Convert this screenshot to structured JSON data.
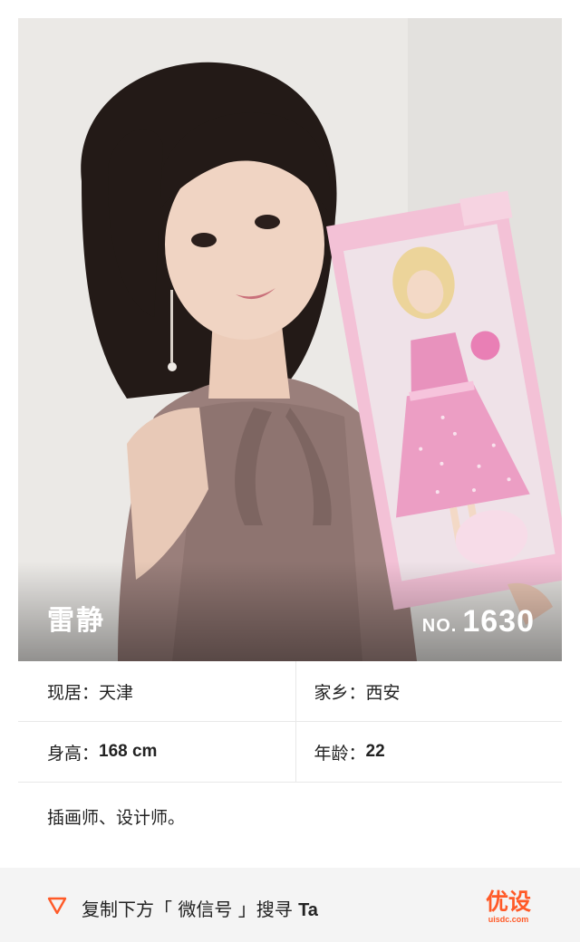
{
  "profile": {
    "name": "雷静",
    "number_prefix": "NO.",
    "number": "1630"
  },
  "details": {
    "residence_label": "现居：",
    "residence_value": "天津",
    "hometown_label": "家乡：",
    "hometown_value": "西安",
    "height_label": "身高：",
    "height_value": "168 cm",
    "age_label": "年龄：",
    "age_value": "22"
  },
  "description": "插画师、设计师。",
  "footer": {
    "icon": "triangle-down-icon",
    "cta_text": "复制下方「 微信号 」搜寻",
    "cta_target": "Ta",
    "accent_color": "#ff5a28"
  },
  "logo": {
    "main": "优设",
    "sub": "uisdc.com"
  }
}
